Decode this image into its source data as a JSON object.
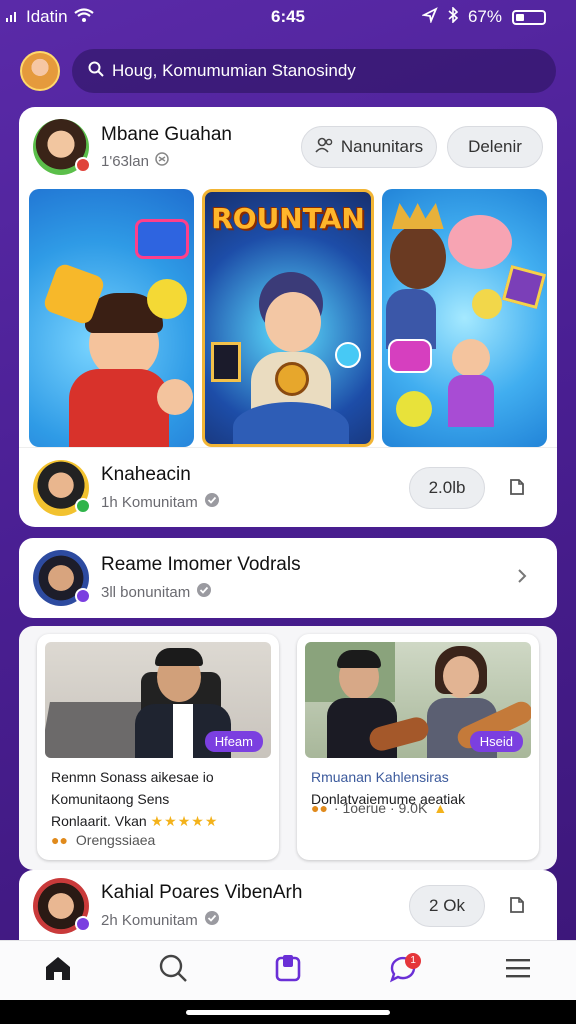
{
  "status": {
    "carrier": "Idatin",
    "time": "6:45",
    "battery": "67%",
    "icons": [
      "wifi-icon",
      "signal-icon",
      "location-icon",
      "bluetooth-icon",
      "battery-icon"
    ]
  },
  "search": {
    "text": "Houg, Komumumian Stanosindy"
  },
  "post1": {
    "name": "Mbane Guahan",
    "sub": "1'63lan",
    "button1": "Nanunitars",
    "button2": "Delenir",
    "gallery_title": "ROUNTAN"
  },
  "community1": {
    "name": "Knaheacin",
    "sub": "1h Komunitam",
    "count": "2.0lb"
  },
  "community2": {
    "name": "Reame Imomer Vodrals",
    "sub": "3ll bonunitam"
  },
  "videos": [
    {
      "tag": "Hfeam",
      "line1": "Renmn Sonass aikesae io",
      "line2": "Komunitaong Sens",
      "line3": "Ronlaarit. Vkan",
      "stars": "★★★★★",
      "meta": "Orengssiaea"
    },
    {
      "tag": "Hseid",
      "line1": "Rmuanan Kahlensiras",
      "line2": "Donlatvaiemume aeatiak",
      "meta": "· 1oerue · 9.0K"
    }
  ],
  "community3": {
    "name": "Kahial Poares VibenArh",
    "sub": "2h Komunitam",
    "count": "2 Ok"
  },
  "tabs": {
    "notification_badge": "1"
  },
  "colors": {
    "background": "#4a1f93",
    "accent": "#7b3fe0",
    "card": "#ffffff",
    "star": "#f3b21b"
  }
}
